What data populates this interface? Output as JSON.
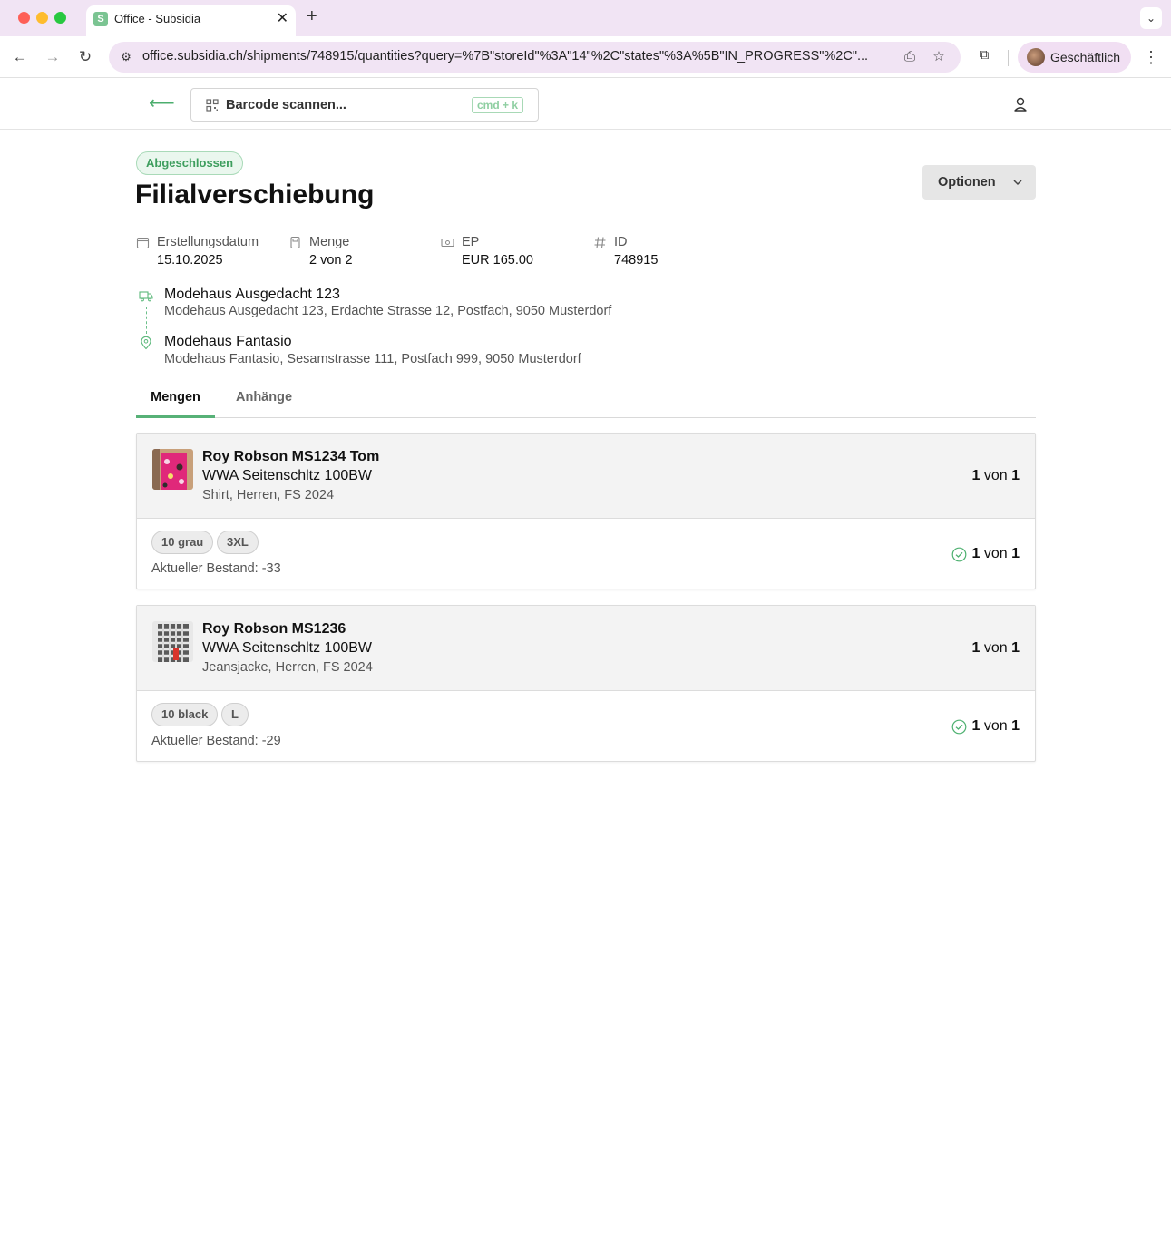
{
  "browser": {
    "tab_title": "Office - Subsidia",
    "tab_favicon": "S",
    "url": "office.subsidia.ch/shipments/748915/quantities?query=%7B\"storeId\"%3A\"14\"%2C\"states\"%3A%5B\"IN_PROGRESS\"%2C\"...",
    "profile_label": "Geschäftlich"
  },
  "header": {
    "barcode_placeholder": "Barcode scannen...",
    "shortcut": "cmd + k"
  },
  "page": {
    "status": "Abgeschlossen",
    "title": "Filialverschiebung",
    "options_label": "Optionen",
    "meta": {
      "created_label": "Erstellungsdatum",
      "created_value": "15.10.2025",
      "quantity_label": "Menge",
      "quantity_value": "2 von 2",
      "price_label": "EP",
      "price_value": "EUR 165.00",
      "id_label": "ID",
      "id_value": "748915"
    },
    "route": {
      "from_name": "Modehaus Ausgedacht 123",
      "from_address": "Modehaus Ausgedacht 123, Erdachte Strasse 12, Postfach, 9050 Musterdorf",
      "to_name": "Modehaus Fantasio",
      "to_address": "Modehaus Fantasio, Sesamstrasse 111, Postfach 999, 9050 Musterdorf"
    },
    "tabs": [
      "Mengen",
      "Anhänge"
    ]
  },
  "products": [
    {
      "title": "Roy Robson MS1234 Tom",
      "subtitle": "WWA Seitenschltz 100BW",
      "meta": "Shirt, Herren, FS 2024",
      "qty_done": "1",
      "qty_sep": "von",
      "qty_total": "1",
      "chips": [
        "10 grau",
        "3XL"
      ],
      "stock": "Aktueller Bestand: -33",
      "variant_qty_done": "1",
      "variant_qty_total": "1"
    },
    {
      "title": "Roy Robson MS1236",
      "subtitle": "WWA Seitenschltz 100BW",
      "meta": "Jeansjacke, Herren, FS 2024",
      "qty_done": "1",
      "qty_sep": "von",
      "qty_total": "1",
      "chips": [
        "10 black",
        "L"
      ],
      "stock": "Aktueller Bestand: -29",
      "variant_qty_done": "1",
      "variant_qty_total": "1"
    }
  ],
  "colors": {
    "accent_green": "#57b177",
    "tabbar_bg": "#f1e4f4",
    "card_head_bg": "#f3f3f3"
  }
}
